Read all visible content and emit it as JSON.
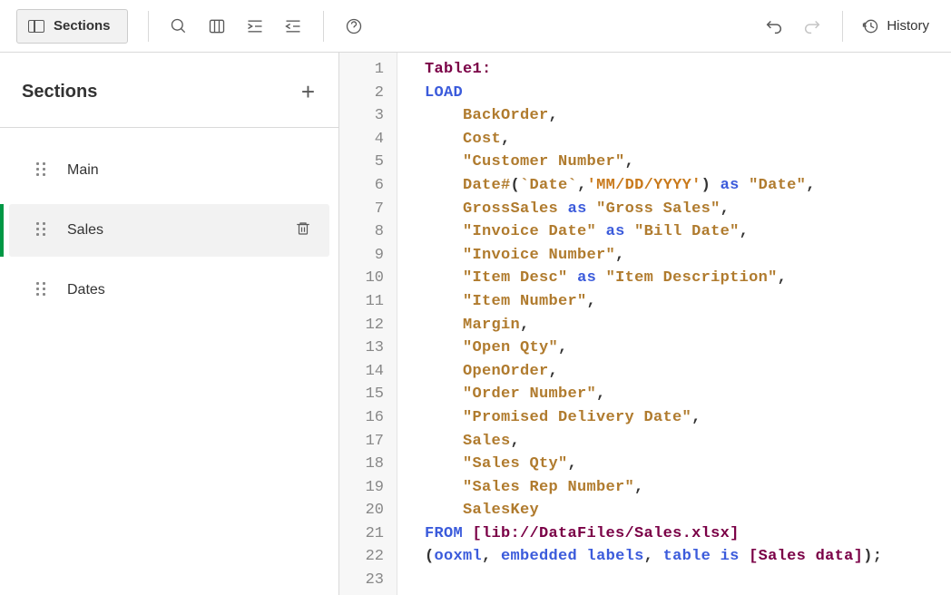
{
  "toolbar": {
    "sections_label": "Sections",
    "history_label": "History"
  },
  "sidebar": {
    "title": "Sections",
    "items": [
      {
        "label": "Main",
        "selected": false
      },
      {
        "label": "Sales",
        "selected": true
      },
      {
        "label": "Dates",
        "selected": false
      }
    ]
  },
  "editor": {
    "line_count": 23,
    "script": {
      "table_name": "Table1",
      "load_fields": [
        {
          "kind": "ident",
          "name": "BackOrder"
        },
        {
          "kind": "ident",
          "name": "Cost"
        },
        {
          "kind": "quoted",
          "name": "Customer Number"
        },
        {
          "kind": "datefn",
          "func": "Date#",
          "src_backtick": "Date",
          "format": "MM/DD/YYYY",
          "alias": "Date"
        },
        {
          "kind": "alias",
          "name": "GrossSales",
          "alias": "Gross Sales"
        },
        {
          "kind": "qalias",
          "name": "Invoice Date",
          "alias": "Bill Date"
        },
        {
          "kind": "quoted",
          "name": "Invoice Number"
        },
        {
          "kind": "qalias",
          "name": "Item Desc",
          "alias": "Item Description"
        },
        {
          "kind": "quoted",
          "name": "Item Number"
        },
        {
          "kind": "ident",
          "name": "Margin"
        },
        {
          "kind": "quoted",
          "name": "Open Qty"
        },
        {
          "kind": "ident",
          "name": "OpenOrder"
        },
        {
          "kind": "quoted",
          "name": "Order Number"
        },
        {
          "kind": "quoted",
          "name": "Promised Delivery Date"
        },
        {
          "kind": "ident",
          "name": "Sales"
        },
        {
          "kind": "quoted",
          "name": "Sales Qty"
        },
        {
          "kind": "quoted",
          "name": "Sales Rep Number"
        },
        {
          "kind": "ident",
          "name": "SalesKey",
          "last": true
        }
      ],
      "from_path": "lib://DataFiles/Sales.xlsx",
      "format_spec": {
        "type": "ooxml",
        "labels": "embedded labels",
        "table_kw": "table",
        "is_kw": "is",
        "table_name": "Sales data"
      }
    }
  }
}
